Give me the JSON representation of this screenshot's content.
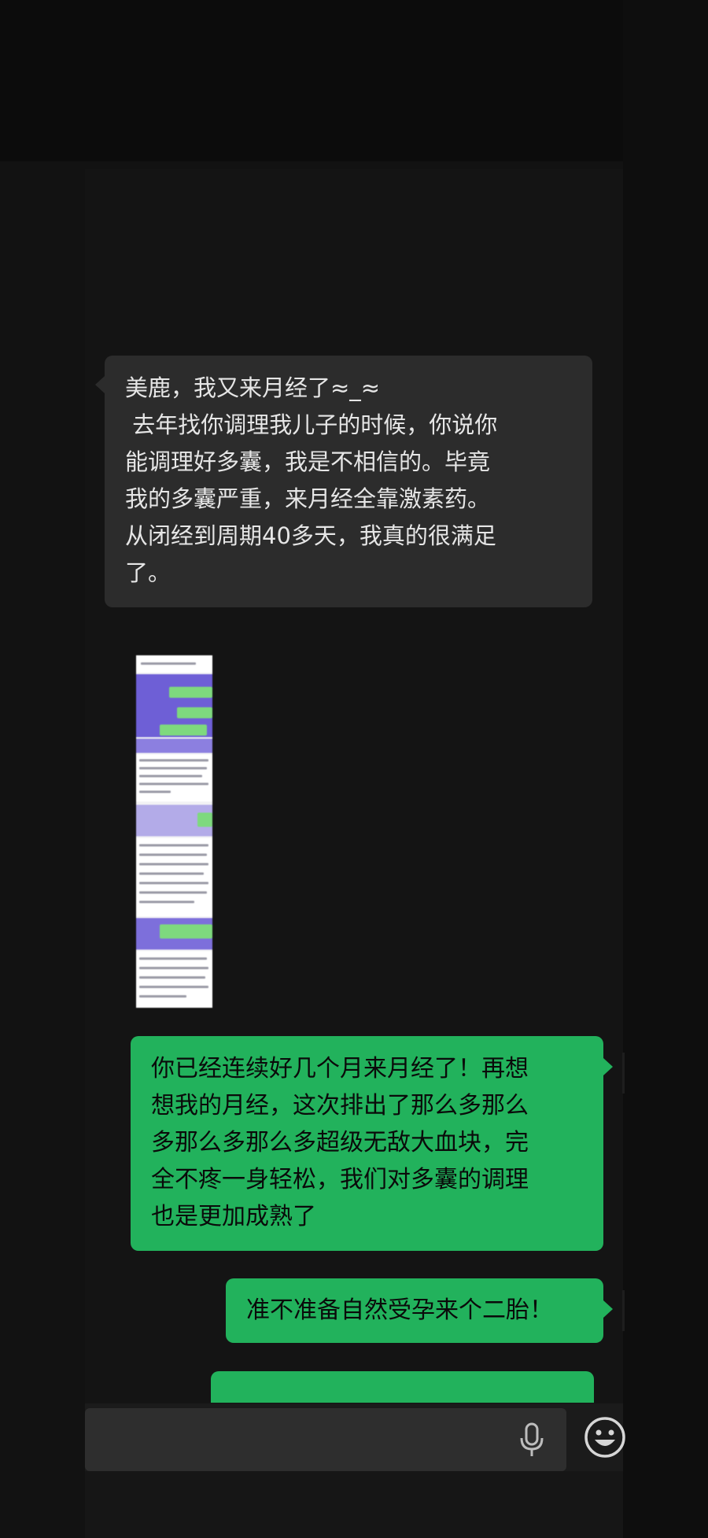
{
  "chat": {
    "messages": [
      {
        "sender": "other",
        "type": "text",
        "lines": [
          "美鹿，我又来月经了≈_≈",
          " 去年找你调理我儿子的时候，你说你",
          "能调理好多囊，我是不相信的。毕竟",
          "我的多囊严重，来月经全靠激素药。",
          "从闭经到周期40多天，我真的很满足",
          "了。"
        ]
      },
      {
        "sender": "self",
        "type": "image",
        "description_icon": "screenshot-thumbnail"
      },
      {
        "sender": "self",
        "type": "text",
        "lines": [
          "你已经连续好几个月来月经了！再想",
          "想我的月经，这次排出了那么多那么",
          "多那么多那么多超级无敌大血块，完",
          "全不疼一身轻松，我们对多囊的调理",
          "也是更加成熟了"
        ]
      },
      {
        "sender": "self",
        "type": "text",
        "lines": [
          "准不准备自然受孕来个二胎！"
        ]
      },
      {
        "sender": "self",
        "type": "text-partial",
        "lines": [
          ""
        ]
      }
    ]
  },
  "input_bar": {
    "value": "",
    "icons": [
      "microphone-icon",
      "emoji-icon"
    ]
  },
  "colors": {
    "incoming_bubble": "#2c2c2c",
    "outgoing_bubble": "#22b25c",
    "background": "#121212"
  }
}
